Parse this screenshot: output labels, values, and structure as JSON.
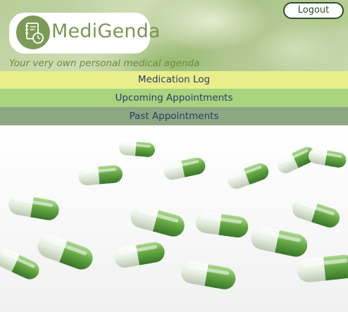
{
  "app": {
    "name": "MediGenda",
    "tagline": "Your very own personal medical agenda"
  },
  "header": {
    "logout_label": "Logout"
  },
  "nav": {
    "items": [
      {
        "label": "Medication Log"
      },
      {
        "label": "Upcoming Appointments"
      },
      {
        "label": "Past Appointments"
      }
    ]
  },
  "colors": {
    "brand_green": "#7b9656",
    "nav_log": "#e8ee8a",
    "nav_upcoming": "#a9d37f",
    "nav_past": "#8fa683",
    "nav_text": "#2b3d63"
  },
  "icons": {
    "logo": "agenda-clock-icon"
  }
}
